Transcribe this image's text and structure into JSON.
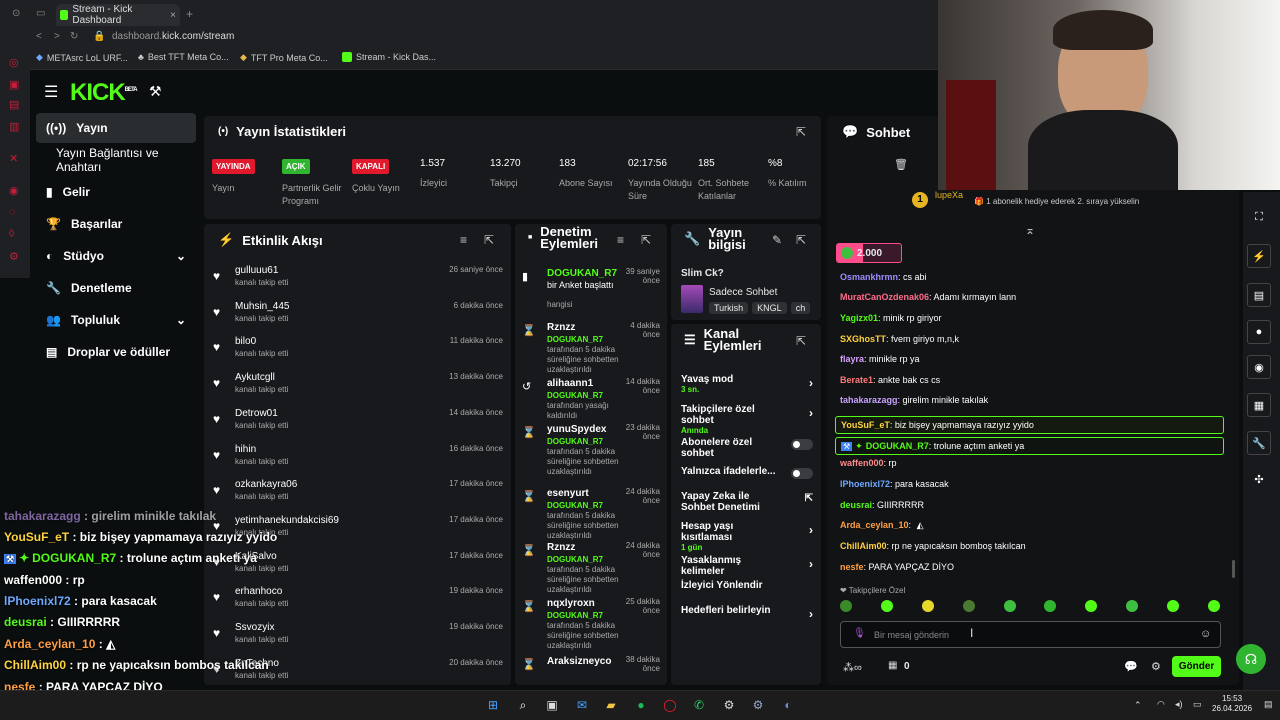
{
  "browser": {
    "tab_title": "Stream - Kick Dashboard",
    "url_host": "dashboard.",
    "url_rest": "kick.com/stream",
    "bookmarks": [
      "METAsrc LoL URF...",
      "Best TFT Meta Co...",
      "TFT Pro Meta Co...",
      "Stream - Kick Das..."
    ]
  },
  "app": {
    "logo": "KICK",
    "logo_sup": "BETA"
  },
  "nav": [
    {
      "label": "Yayın"
    },
    {
      "label": "Yayın Bağlantısı ve Anahtarı"
    },
    {
      "label": "Gelir"
    },
    {
      "label": "Başarılar"
    },
    {
      "label": "Stüdyo"
    },
    {
      "label": "Denetleme"
    },
    {
      "label": "Topluluk"
    },
    {
      "label": "Droplar ve ödüller"
    }
  ],
  "stats": {
    "title": "Yayın İstatistikleri",
    "items": [
      {
        "badge": "YAYINDA",
        "badge_color": "#e0192d",
        "label": "Yayın"
      },
      {
        "badge": "AÇIK",
        "badge_color": "#2fb52f",
        "label": "Partnerlik Gelir Programı"
      },
      {
        "badge": "KAPALI",
        "badge_color": "#e0192d",
        "label": "Çoklu Yayın"
      },
      {
        "value": "1.537",
        "label": "İzleyici"
      },
      {
        "value": "13.270",
        "label": "Takipçi"
      },
      {
        "value": "183",
        "label": "Abone Sayısı"
      },
      {
        "value": "02:17:56",
        "label": "Yayında Olduğu Süre"
      },
      {
        "value": "185",
        "label": "Ort. Sohbete Katılanlar"
      },
      {
        "value": "%8",
        "label": "% Katılım"
      }
    ]
  },
  "activity": {
    "title": "Etkinlik Akışı",
    "items": [
      {
        "name": "gulluuu61",
        "sub": "kanalı takip etti",
        "time": "26 saniye önce"
      },
      {
        "name": "Muhsin_445",
        "sub": "kanalı takip etti",
        "time": "6 dakika önce"
      },
      {
        "name": "bilo0",
        "sub": "kanalı takip etti",
        "time": "11 dakika önce"
      },
      {
        "name": "Aykutcgll",
        "sub": "kanalı takip etti",
        "time": "13 dakika önce"
      },
      {
        "name": "Detrow01",
        "sub": "kanalı takip etti",
        "time": "14 dakika önce"
      },
      {
        "name": "hihin",
        "sub": "kanalı takip etti",
        "time": "16 dakika önce"
      },
      {
        "name": "ozkankayra06",
        "sub": "kanalı takip etti",
        "time": "17 dakika önce"
      },
      {
        "name": "yetimhanekundakcisi69",
        "sub": "kanalı takip etti",
        "time": "17 dakika önce"
      },
      {
        "name": "KaliSalvo",
        "sub": "kanalı takip etti",
        "time": "17 dakika önce"
      },
      {
        "name": "erhanhoco",
        "sub": "kanalı takip etti",
        "time": "19 dakika önce"
      },
      {
        "name": "Ssvozyix",
        "sub": "kanalı takip etti",
        "time": "19 dakika önce"
      },
      {
        "name": "ZnTechno",
        "sub": "kanalı takip etti",
        "time": "20 dakika önce"
      }
    ]
  },
  "moderation": {
    "title": "Denetim Eylemleri",
    "items": [
      {
        "name": "DOGUKAN_R7",
        "green": true,
        "desc": "bir Anket başlattı",
        "desc2": "hangisi",
        "time": "39 saniye önce"
      },
      {
        "name": "Rznzz",
        "mod": "DOGUKAN_R7",
        "desc": "tarafından 5 dakika süreliğine sohbetten uzaklaştırıldı",
        "time": "4 dakika önce"
      },
      {
        "name": "alihaann1",
        "mod": "DOGUKAN_R7",
        "desc": "tarafından yasağı kaldırıldı",
        "time": "14 dakika önce"
      },
      {
        "name": "yunuSpydex",
        "mod": "DOGUKAN_R7",
        "desc": "tarafından 5 dakika süreliğine sohbetten uzaklaştırıldı",
        "time": "23 dakika önce"
      },
      {
        "name": "esenyurt",
        "mod": "DOGUKAN_R7",
        "desc": "tarafından 5 dakika süreliğine sohbetten uzaklaştırıldı",
        "time": "24 dakika önce"
      },
      {
        "name": "Rznzz",
        "mod": "DOGUKAN_R7",
        "desc": "tarafından 5 dakika süreliğine sohbetten uzaklaştırıldı",
        "time": "24 dakika önce"
      },
      {
        "name": "nqxlyroxn",
        "mod": "DOGUKAN_R7",
        "desc": "tarafından 5 dakika süreliğine sohbetten uzaklaştırıldı",
        "time": "25 dakika önce"
      },
      {
        "name": "Araksizneyco",
        "time": "38 dakika önce"
      }
    ]
  },
  "stream_info": {
    "title": "Yayın bilgisi",
    "stream_title": "Slim Ck?",
    "category": "Sadece Sohbet",
    "tags": [
      "Turkish",
      "KNGL",
      "ch"
    ]
  },
  "channel_actions": {
    "title": "Kanal Eylemleri",
    "items": [
      {
        "label": "Yavaş mod",
        "sub": "3 sn.",
        "type": "chevron"
      },
      {
        "label": "Takipçilere özel sohbet",
        "sub": "Anında",
        "type": "chevron"
      },
      {
        "label": "Abonelere özel sohbet",
        "type": "toggle"
      },
      {
        "label": "Yalnızca ifadelerle...",
        "type": "toggle"
      },
      {
        "label": "Yapay Zeka ile Sohbet Denetimi",
        "type": "external"
      },
      {
        "label": "Hesap yaşı kısıtlaması",
        "sub": "1 gün",
        "type": "chevron"
      },
      {
        "label": "Yasaklanmış kelimeler",
        "type": "chevron"
      },
      {
        "label": "İzleyici Yönlendir",
        "type": "none"
      },
      {
        "label": "Hedefleri belirleyin",
        "type": "chevron"
      }
    ]
  },
  "chat": {
    "title": "Sohbet",
    "pinned_user": "lupeXa",
    "pinned_rank": "1",
    "pinned_text": "1 abonelik hediye ederek 2. sıraya yükselin",
    "goal": "2.000",
    "messages": [
      {
        "user": "Osmankhrmn",
        "color": "#9b8cff",
        "text": "cs abi"
      },
      {
        "user": "MuratCanOzdenak06",
        "color": "#ff6b8b",
        "text": "Adamı kırmayın lann"
      },
      {
        "user": "Yagizx01",
        "color": "#53fc18",
        "text": "minik rp giriyor"
      },
      {
        "user": "SXGhosTT",
        "color": "#ffd23f",
        "text": "fvem giriyo m,n,k"
      },
      {
        "user": "flayra",
        "color": "#d7a0ff",
        "text": "minikle rp ya"
      },
      {
        "user": "Berate1",
        "color": "#ff7a7a",
        "text": "ankte bak cs cs"
      },
      {
        "user": "tahakarazagg",
        "color": "#c9a0ff",
        "text": "girelim minikle takılak"
      },
      {
        "user": "YouSuF_eT",
        "color": "#ffd23f",
        "text": "biz bişey yapmamaya razıyız yyido",
        "highlight": true
      },
      {
        "user": "DOGUKAN_R7",
        "color": "#53fc18",
        "text": "trolune açtım anketi ya",
        "highlight": true
      },
      {
        "user": "waffen000",
        "color": "#ff8a8a",
        "text": "rp"
      },
      {
        "user": "lPhoenixl72",
        "color": "#6fa8ff",
        "text": "para kasacak"
      },
      {
        "user": "deusrai",
        "color": "#53fc18",
        "text": "GIIIRRRRR"
      },
      {
        "user": "Arda_ceylan_10",
        "color": "#ff9f43",
        "text": ""
      },
      {
        "user": "ChillAim00",
        "color": "#ffd23f",
        "text": "rp ne yapıcaksın bomboş takılcan"
      },
      {
        "user": "nesfe",
        "color": "#ff9f43",
        "text": "PARA YAPÇAZ DİYO"
      }
    ],
    "emote_section": "Takipçilere Özel",
    "input_placeholder": "Bir mesaj gönderin",
    "points": "0",
    "send": "Gönder"
  },
  "overlay_chat": [
    {
      "user": "tahakarazagg",
      "text": "girelim minikle takılak",
      "color": "#c9a0ff"
    },
    {
      "user": "YouSuF_eT",
      "text": "biz bişey yapmamaya razıyız yyido",
      "color": "#ffd23f"
    },
    {
      "user": "DOGUKAN_R7",
      "text": "trolune açtım anketi ya",
      "color": "#53fc18"
    },
    {
      "user": "waffen000",
      "text": "rp",
      "color": "#ffffff"
    },
    {
      "user": "lPhoenixl72",
      "text": "para kasacak",
      "color": "#6fa8ff"
    },
    {
      "user": "deusrai",
      "text": "GIIIRRRRR",
      "color": "#53fc18"
    },
    {
      "user": "Arda_ceylan_10",
      "text": "",
      "color": "#ff9f43"
    },
    {
      "user": "ChillAim00",
      "text": "rp ne yapıcaksın bomboş takılcan",
      "color": "#ffd23f"
    },
    {
      "user": "nesfe",
      "text": "PARA YAPÇAZ DİYO",
      "color": "#ff9f43"
    }
  ],
  "taskbar": {
    "time": "15:53",
    "date": "26.04.2026"
  }
}
